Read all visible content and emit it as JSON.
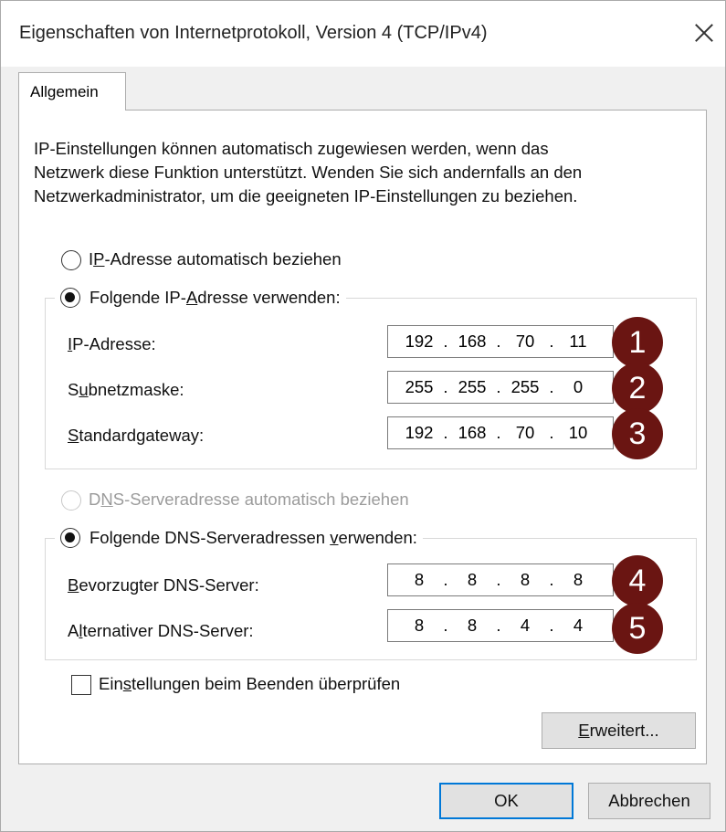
{
  "window": {
    "title": "Eigenschaften von Internetprotokoll, Version 4 (TCP/IPv4)"
  },
  "tabs": [
    {
      "label": "Allgemein"
    }
  ],
  "description": {
    "lines": [
      "IP-Einstellungen können automatisch zugewiesen werden, wenn das",
      "Netzwerk diese Funktion unterstützt. Wenden Sie sich andernfalls an den",
      "Netzwerkadministrator, um die geeigneten IP-Einstellungen zu beziehen."
    ]
  },
  "ip_mode": {
    "auto": {
      "before": "I",
      "mnemonic": "P",
      "after": "-Adresse automatisch beziehen",
      "selected": false
    },
    "manual": {
      "before": "Folgende IP-",
      "mnemonic": "A",
      "after": "dresse verwenden:",
      "selected": true
    }
  },
  "ip_fields": [
    {
      "label_before": "",
      "mnemonic": "I",
      "label_after": "P-Adresse:",
      "octets": [
        "192",
        "168",
        "70",
        "11"
      ],
      "badge": "1"
    },
    {
      "label_before": "S",
      "mnemonic": "u",
      "label_after": "bnetzmaske:",
      "octets": [
        "255",
        "255",
        "255",
        "0"
      ],
      "badge": "2"
    },
    {
      "label_before": "",
      "mnemonic": "S",
      "label_after": "tandardgateway:",
      "octets": [
        "192",
        "168",
        "70",
        "10"
      ],
      "badge": "3"
    }
  ],
  "dns_mode": {
    "auto": {
      "before": "D",
      "mnemonic": "N",
      "after": "S-Serveradresse automatisch beziehen",
      "selected": false,
      "disabled": true
    },
    "manual": {
      "before": "Folgende DNS-Serveradressen ",
      "mnemonic": "v",
      "after": "erwenden:",
      "selected": true
    }
  },
  "dns_fields": [
    {
      "label_before": "",
      "mnemonic": "B",
      "label_after": "evorzugter DNS-Server:",
      "octets": [
        "8",
        "8",
        "8",
        "8"
      ],
      "badge": "4"
    },
    {
      "label_before": "A",
      "mnemonic": "l",
      "label_after": "ternativer DNS-Server:",
      "octets": [
        "8",
        "8",
        "4",
        "4"
      ],
      "badge": "5"
    }
  ],
  "validate_checkbox": {
    "before": "Ein",
    "mnemonic": "s",
    "after": "tellungen beim Beenden überprüfen",
    "checked": false
  },
  "buttons": {
    "advanced": {
      "mnemonic": "E",
      "after": "rweitert..."
    },
    "ok": "OK",
    "cancel": "Abbrechen"
  },
  "colors": {
    "badge": "#6a1512",
    "window_bg": "#f0f0f0",
    "panel_bg": "#ffffff"
  }
}
